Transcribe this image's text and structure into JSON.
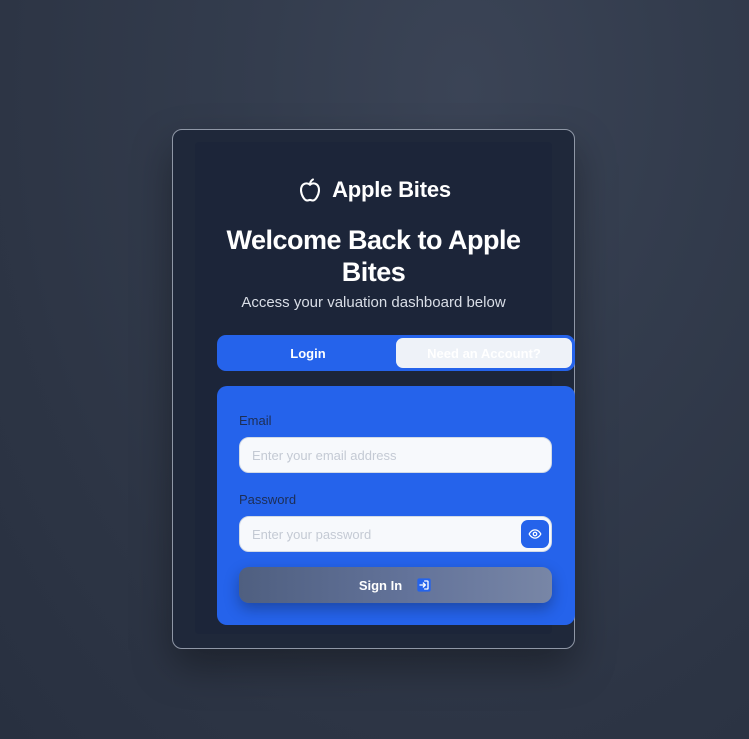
{
  "brand": {
    "name": "Apple Bites",
    "icon": "apple-icon"
  },
  "heading": {
    "title": "Welcome Back to Apple Bites",
    "subtitle": "Access your valuation dashboard below"
  },
  "tabs": [
    {
      "label": "Login",
      "active": true
    },
    {
      "label": "Need an Account?",
      "active": false
    }
  ],
  "form": {
    "email": {
      "label": "Email",
      "placeholder": "Enter your email address",
      "value": ""
    },
    "password": {
      "label": "Password",
      "placeholder": "Enter your password",
      "value": "",
      "toggle_icon": "eye-icon"
    },
    "submit": {
      "label": "Sign In",
      "icon": "sign-in-icon"
    }
  },
  "colors": {
    "accent": "#2563eb",
    "card": "#1f283a",
    "background": "#303949"
  }
}
